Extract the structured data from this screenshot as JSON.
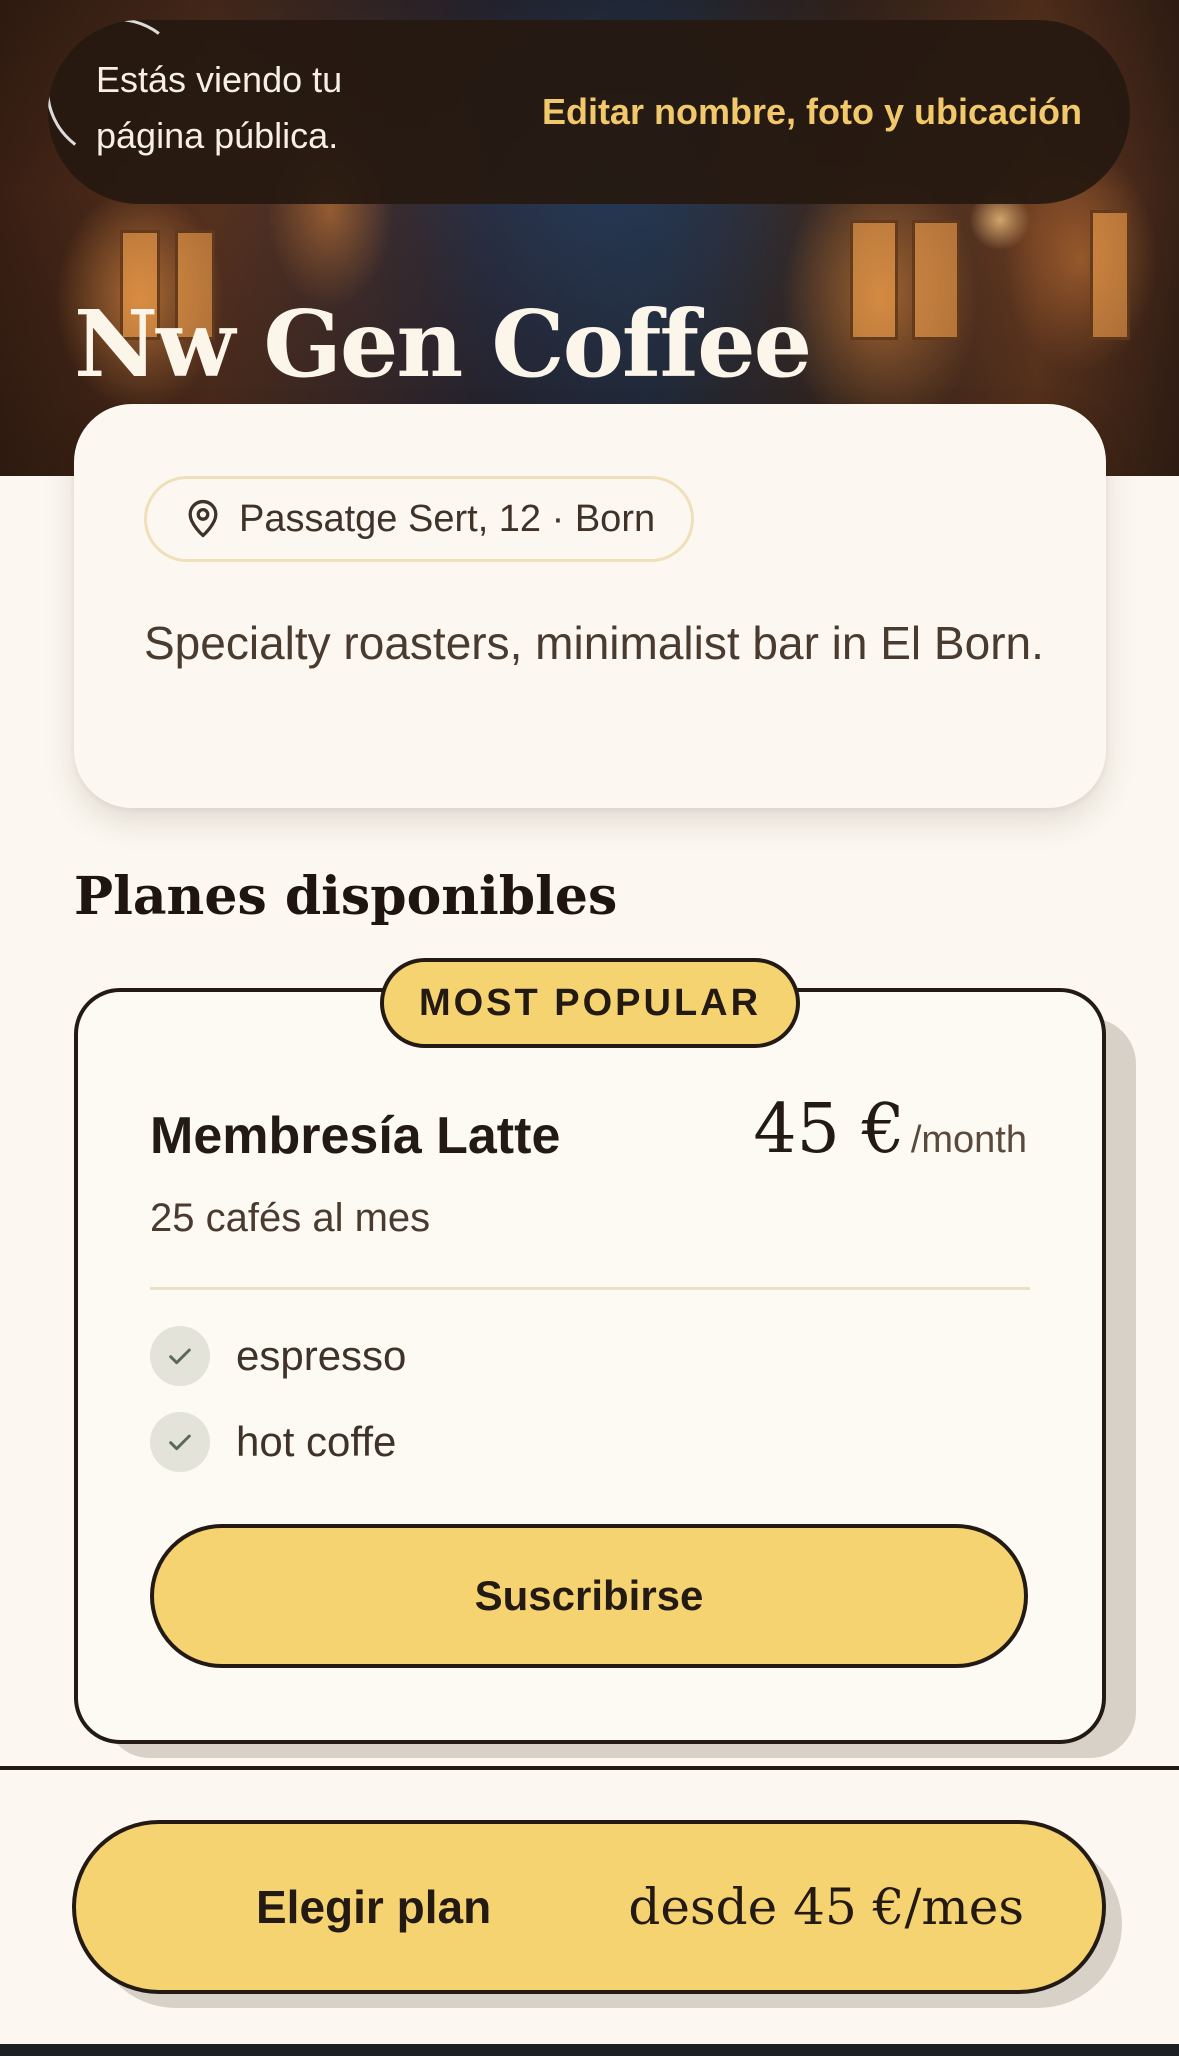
{
  "banner": {
    "message": "Estás viendo tu página pública.",
    "edit_link": "Editar nombre, foto y ubicación"
  },
  "cafe": {
    "name": "Nw Gen Coffee",
    "location": "Passatge Sert, 12 · Born",
    "location_icon": "map-pin-icon",
    "description": "Specialty roasters, minimalist bar in El Born."
  },
  "plans_section": {
    "title": "Planes disponibles"
  },
  "plan": {
    "badge": "MOST POPULAR",
    "name": "Membresía Latte",
    "price": "45 €",
    "period": "/month",
    "subtitle": "25 cafés al mes",
    "features": [
      {
        "label": "espresso",
        "icon": "check-icon"
      },
      {
        "label": "hot coffe",
        "icon": "check-icon"
      }
    ],
    "subscribe_label": "Suscribirse"
  },
  "cta": {
    "label": "Elegir plan",
    "price_text": "desde 45 €/mes"
  },
  "colors": {
    "accent": "#f6d371",
    "ink": "#241a14",
    "background": "#fcf8f1",
    "banner_link": "#f2c96a"
  }
}
